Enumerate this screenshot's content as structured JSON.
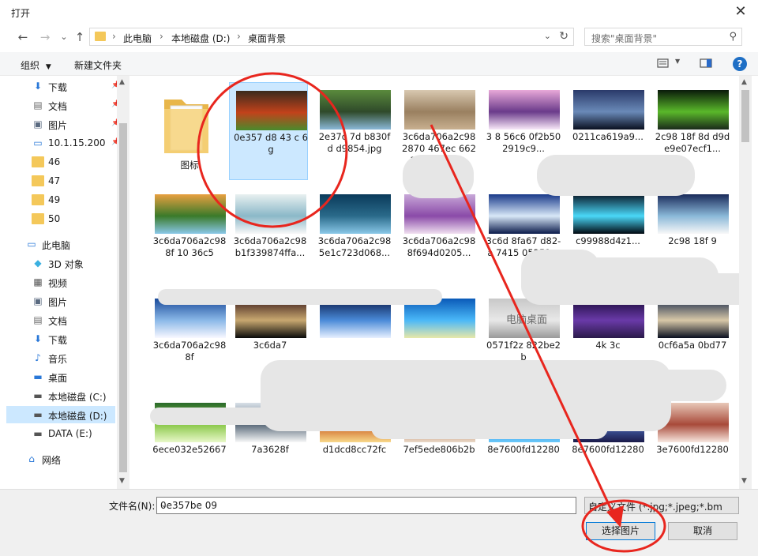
{
  "window": {
    "title": "打开",
    "close_label": "✕"
  },
  "nav": {
    "back": "←",
    "forward": "→",
    "recent": "⌄",
    "up": "↑"
  },
  "breadcrumb": [
    "此电脑",
    "本地磁盘 (D:)",
    "桌面背景"
  ],
  "search": {
    "placeholder": "搜索\"桌面背景\""
  },
  "toolbar": {
    "organize": "组织",
    "new_folder": "新建文件夹"
  },
  "sidebar": {
    "items": [
      {
        "label": "下载",
        "icon": "download-icon",
        "pinned": true
      },
      {
        "label": "文档",
        "icon": "document-icon",
        "pinned": true
      },
      {
        "label": "图片",
        "icon": "picture-icon",
        "pinned": true
      },
      {
        "label": "10.1.15.200",
        "icon": "network-drive-icon",
        "pinned": true
      },
      {
        "label": "46",
        "icon": "folder-icon"
      },
      {
        "label": "47",
        "icon": "folder-icon"
      },
      {
        "label": "49",
        "icon": "folder-icon"
      },
      {
        "label": "50",
        "icon": "folder-icon"
      },
      {
        "label": "此电脑",
        "icon": "computer-icon"
      },
      {
        "label": "3D 对象",
        "icon": "3d-objects-icon"
      },
      {
        "label": "视频",
        "icon": "video-icon"
      },
      {
        "label": "图片",
        "icon": "picture-icon"
      },
      {
        "label": "文档",
        "icon": "document-icon"
      },
      {
        "label": "下载",
        "icon": "download-icon"
      },
      {
        "label": "音乐",
        "icon": "music-icon"
      },
      {
        "label": "桌面",
        "icon": "desktop-icon"
      },
      {
        "label": "本地磁盘 (C:)",
        "icon": "drive-icon"
      },
      {
        "label": "本地磁盘 (D:)",
        "icon": "drive-icon",
        "selected": true
      },
      {
        "label": "DATA (E:)",
        "icon": "drive-icon"
      },
      {
        "label": "网络",
        "icon": "network-icon"
      }
    ]
  },
  "files": [
    {
      "label": "图标",
      "type": "folder"
    },
    {
      "label": "0e357 d8 43 c 6 g",
      "colors": [
        "#3a2a1c",
        "#c2421b",
        "#4a8a2c"
      ],
      "selected": true
    },
    {
      "label": "2e37c 7d b830f d d9854.jpg",
      "colors": [
        "#5a8a3c",
        "#2f4a2a",
        "#8ab8d8"
      ]
    },
    {
      "label": "3c6da706a2c98 2870 467ec 6621b52f27a7...",
      "colors": [
        "#d8c8b0",
        "#9a8060",
        "#c8b090"
      ]
    },
    {
      "label": "3 8 56c6 0f2b502919c9...",
      "colors": [
        "#e8a8d8",
        "#6a3a8a",
        "#f8e8f8"
      ]
    },
    {
      "label": "0211ca619a9...",
      "colors": [
        "#2a3a6a",
        "#6a8ab8",
        "#0a1020"
      ]
    },
    {
      "label": "2c98 18f 8d d9de9e07ecf1...",
      "colors": [
        "#0a1a0a",
        "#5ab82a",
        "#1a2a1a"
      ]
    },
    {
      "label": "3c6da706a2c98 8f 10 36c5",
      "colors": [
        "#e8a040",
        "#3a7a2a",
        "#8ac8e8"
      ]
    },
    {
      "label": "3c6da706a2c98 b1f339874ffa...",
      "colors": [
        "#e8f0f0",
        "#8ab8c8",
        "#f8f8f8"
      ]
    },
    {
      "label": "3c6da706a2c98 5e1c723d068...",
      "colors": [
        "#0a3a5a",
        "#2a6a8a",
        "#8ac8e8"
      ]
    },
    {
      "label": "3c6da706a2c98 8f694d0205...",
      "colors": [
        "#c8a8d8",
        "#8a4aa8",
        "#f0e0f0"
      ]
    },
    {
      "label": "3c6d 8fa67 d82-a 7415 05251...",
      "colors": [
        "#1a3a8a",
        "#d8e8f8",
        "#0a1a4a"
      ]
    },
    {
      "label": "c99988d4z1...",
      "colors": [
        "#0a1a2a",
        "#4ad8f8",
        "#000810"
      ]
    },
    {
      "label": "2c98 18f 9",
      "colors": [
        "#1a2a5a",
        "#8ab8d8",
        "#f8f8f8"
      ]
    },
    {
      "label": "3c6da706a2c98 8f",
      "colors": [
        "#1a4a9a",
        "#8ab8e8",
        "#f8f8ff"
      ]
    },
    {
      "label": "3c6da7",
      "colors": [
        "#3a1a1a",
        "#c8a870",
        "#0a0a0a"
      ]
    },
    {
      "label": "",
      "colors": [
        "#0a1a4a",
        "#4a8ad8",
        "#e8f0ff"
      ]
    },
    {
      "label": "",
      "colors": [
        "#0a5ab8",
        "#4ab8f8",
        "#e8e8a8"
      ]
    },
    {
      "label": "0571f2z 822be2b",
      "colors": [
        "#c8c8c8",
        "#e8e8e8",
        "#9a9a9a"
      ],
      "caption": "电脑桌面"
    },
    {
      "label": "4k 3c",
      "colors": [
        "#1a0a3a",
        "#6a3aa8",
        "#2a1a4a"
      ]
    },
    {
      "label": "0cf6a5a 0bd77",
      "colors": [
        "#1a2a4a",
        "#d8c8a8",
        "#0a1020"
      ]
    },
    {
      "label": "6ece032e52667",
      "colors": [
        "#2a6a2a",
        "#8ac84a",
        "#e8f8c8"
      ]
    },
    {
      "label": "7a3628f",
      "colors": [
        "#d8e0e8",
        "#5a6a7a",
        "#f8f8f8"
      ]
    },
    {
      "label": "d1dcd8cc72fc",
      "colors": [
        "#e89a2a",
        "#c8581a",
        "#f8d88a"
      ]
    },
    {
      "label": "7ef5ede806b2b",
      "colors": [
        "#f8f0e8",
        "#b86a3a",
        "#e8d8c8"
      ]
    },
    {
      "label": "8e7600fd12280",
      "colors": [
        "#0a3a8a",
        "#2a8ae8",
        "#6ac8f8"
      ]
    },
    {
      "label": "8e7600fd12280",
      "colors": [
        "#0a0a2a",
        "#4a6ab8",
        "#1a1a4a"
      ]
    },
    {
      "label": "3e7600fd12280",
      "colors": [
        "#e8c8b8",
        "#a84a3a",
        "#f8e8e0"
      ]
    }
  ],
  "bottom": {
    "filename_label": "文件名(N):",
    "filename_value": "0e357be 09",
    "filter_value": "自定义文件 (*.jpg;*.jpeg;*.bmp;*.",
    "select_button": "选择图片",
    "cancel_button": "取消"
  },
  "colors": {
    "selection": "#cce8ff",
    "annotation": "#e8261e",
    "accent": "#0078d7"
  }
}
